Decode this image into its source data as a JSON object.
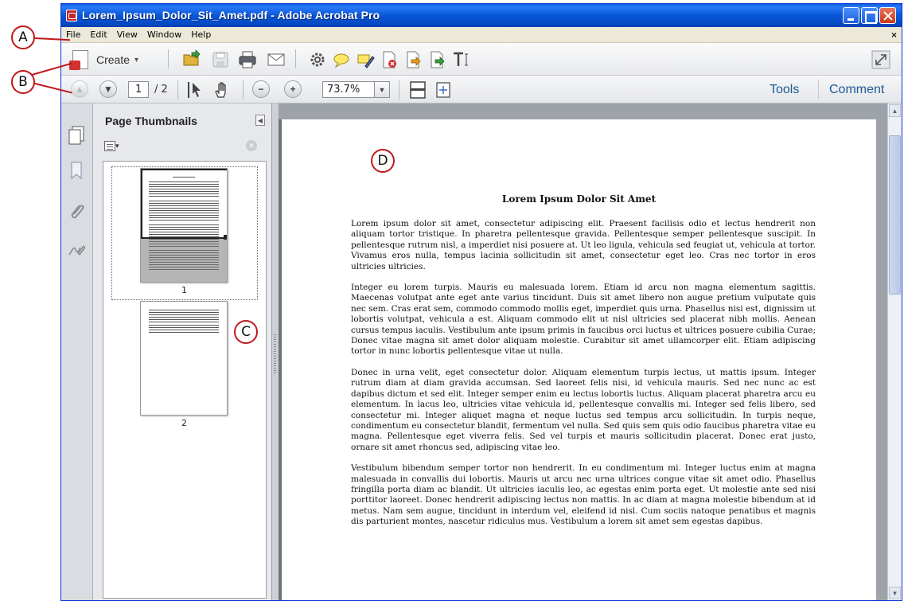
{
  "window": {
    "title": "Lorem_Ipsum_Dolor_Sit_Amet.pdf - Adobe Acrobat Pro"
  },
  "menu": {
    "items": [
      "File",
      "Edit",
      "View",
      "Window",
      "Help"
    ],
    "close_glyph": "×"
  },
  "toolbar": {
    "create_label": "Create",
    "create_caret": "▾",
    "icons": [
      "open-icon",
      "save-icon",
      "print-icon",
      "email-icon",
      "settings-icon",
      "comment-icon",
      "highlight-icon",
      "pdf-tool-icon",
      "export-icon",
      "share-icon",
      "text-edit-icon",
      "fullscreen-icon"
    ]
  },
  "nav": {
    "current_page": "1",
    "page_total": "/ 2",
    "zoom": "73.7%",
    "tools_label": "Tools",
    "comment_label": "Comment"
  },
  "thumbnails": {
    "title": "Page Thumbnails",
    "pages": [
      {
        "label": "1"
      },
      {
        "label": "2"
      }
    ]
  },
  "document": {
    "title": "Lorem Ipsum Dolor Sit Amet",
    "paragraphs": [
      "Lorem ipsum dolor sit amet, consectetur adipiscing elit. Praesent facilisis odio et lectus hendrerit non aliquam tortor tristique. In pharetra pellentesque gravida. Pellentesque semper pellentesque suscipit. In pellentesque rutrum nisl, a imperdiet nisi posuere at. Ut leo ligula, vehicula sed feugiat ut, vehicula at tortor. Vivamus eros nulla, tempus lacinia sollicitudin sit amet, consectetur eget leo. Cras nec tortor in eros ultricies ultricies.",
      "Integer eu lorem turpis. Mauris eu malesuada lorem. Etiam id arcu non magna elementum sagittis. Maecenas volutpat ante eget ante varius tincidunt. Duis sit amet libero non augue pretium vulputate quis nec sem. Cras erat sem, commodo commodo mollis eget, imperdiet quis urna. Phasellus nisi est, dignissim ut lobortis volutpat, vehicula a est. Aliquam commodo elit ut nisl ultricies sed placerat nibh mollis. Aenean cursus tempus iaculis. Vestibulum ante ipsum primis in faucibus orci luctus et ultrices posuere cubilia Curae; Donec vitae magna sit amet dolor aliquam molestie. Curabitur sit amet ullamcorper elit. Etiam adipiscing tortor in nunc lobortis pellentesque vitae ut nulla.",
      "Donec in urna velit, eget consectetur dolor. Aliquam elementum turpis lectus, ut mattis ipsum. Integer rutrum diam at diam gravida accumsan. Sed laoreet felis nisi, id vehicula mauris. Sed nec nunc ac est dapibus dictum et sed elit. Integer semper enim eu lectus lobortis luctus. Aliquam placerat pharetra arcu eu elementum. In lacus leo, ultricies vitae vehicula id, pellentesque convallis mi. Integer sed felis libero, sed consectetur mi. Integer aliquet magna et neque luctus sed tempus arcu sollicitudin. In turpis neque, condimentum eu consectetur blandit, fermentum vel nulla. Sed quis sem quis odio faucibus pharetra vitae eu magna. Pellentesque eget viverra felis. Sed vel turpis et mauris sollicitudin placerat. Donec erat justo, ornare sit amet rhoncus sed, adipiscing vitae leo.",
      "Vestibulum bibendum semper tortor non hendrerit. In eu condimentum mi. Integer luctus enim at magna malesuada in convallis dui lobortis. Mauris ut arcu nec urna ultrices congue vitae sit amet odio. Phasellus fringilla porta diam ac blandit. Ut ultricies iaculis leo, ac egestas enim porta eget. Ut molestie ante sed nisi porttitor laoreet. Donec hendrerit adipiscing lectus non mattis. In ac diam at magna molestie bibendum at id metus. Nam sem augue, tincidunt in interdum vel, eleifend id nisl. Cum sociis natoque penatibus et magnis dis parturient montes, nascetur ridiculus mus. Vestibulum a lorem sit amet sem egestas dapibus."
    ]
  },
  "callouts": {
    "a": "A",
    "b": "B",
    "c": "C",
    "d": "D"
  },
  "colors": {
    "titlebar": "#0857d8",
    "callout": "#c0181b",
    "link": "#1d5a95"
  }
}
